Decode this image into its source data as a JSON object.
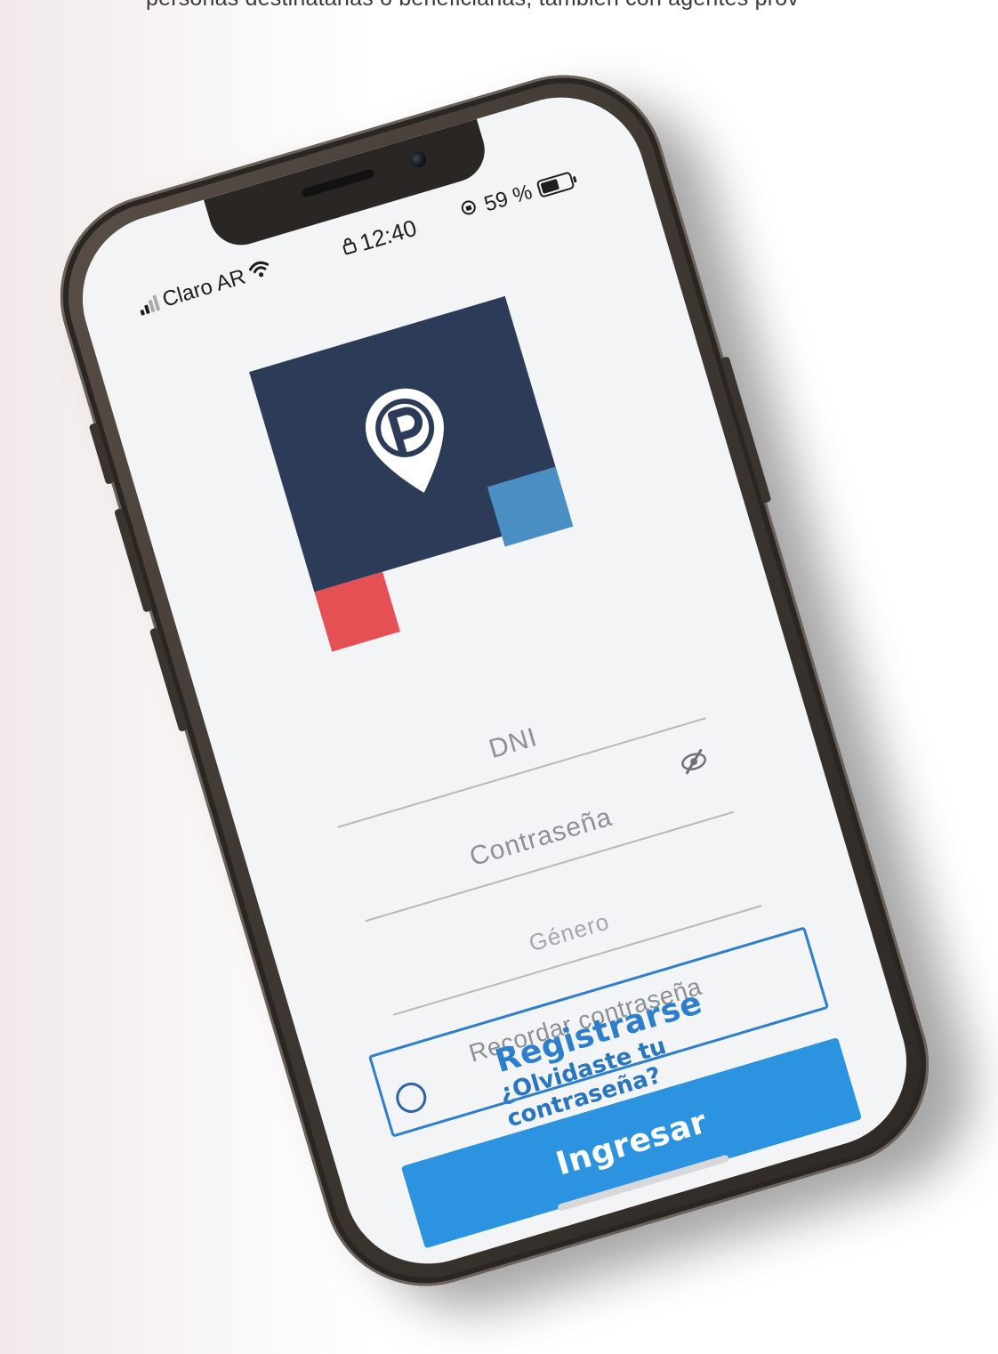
{
  "page": {
    "top_text": "personas destinatarias o beneficiarias, también con agentes prov"
  },
  "status_bar": {
    "carrier": "Claro AR",
    "time": "12:40",
    "battery": "59 %"
  },
  "form": {
    "dni_placeholder": "DNI",
    "password_placeholder": "Contraseña",
    "gender_placeholder": "Género",
    "remember_label": "Recordar contraseña",
    "forgot_link": "¿Olvidaste tu contraseña?"
  },
  "buttons": {
    "register_label": "Registrarse",
    "login_label": "Ingresar"
  },
  "icons": {
    "signal": "signal-icon",
    "wifi": "wifi-icon",
    "lock": "lock-icon",
    "rotation_lock": "rotation-lock-icon",
    "battery": "battery-icon",
    "eye_slash": "eye-slash-icon",
    "logo_pin": "map-pin-p-icon"
  },
  "colors": {
    "logo_navy": "#2c3b57",
    "logo_blue": "#4a8fc4",
    "logo_red": "#e55055",
    "primary_blue": "#2b93df",
    "outline_blue": "#2d7ecc",
    "link_blue": "#2876c0"
  }
}
